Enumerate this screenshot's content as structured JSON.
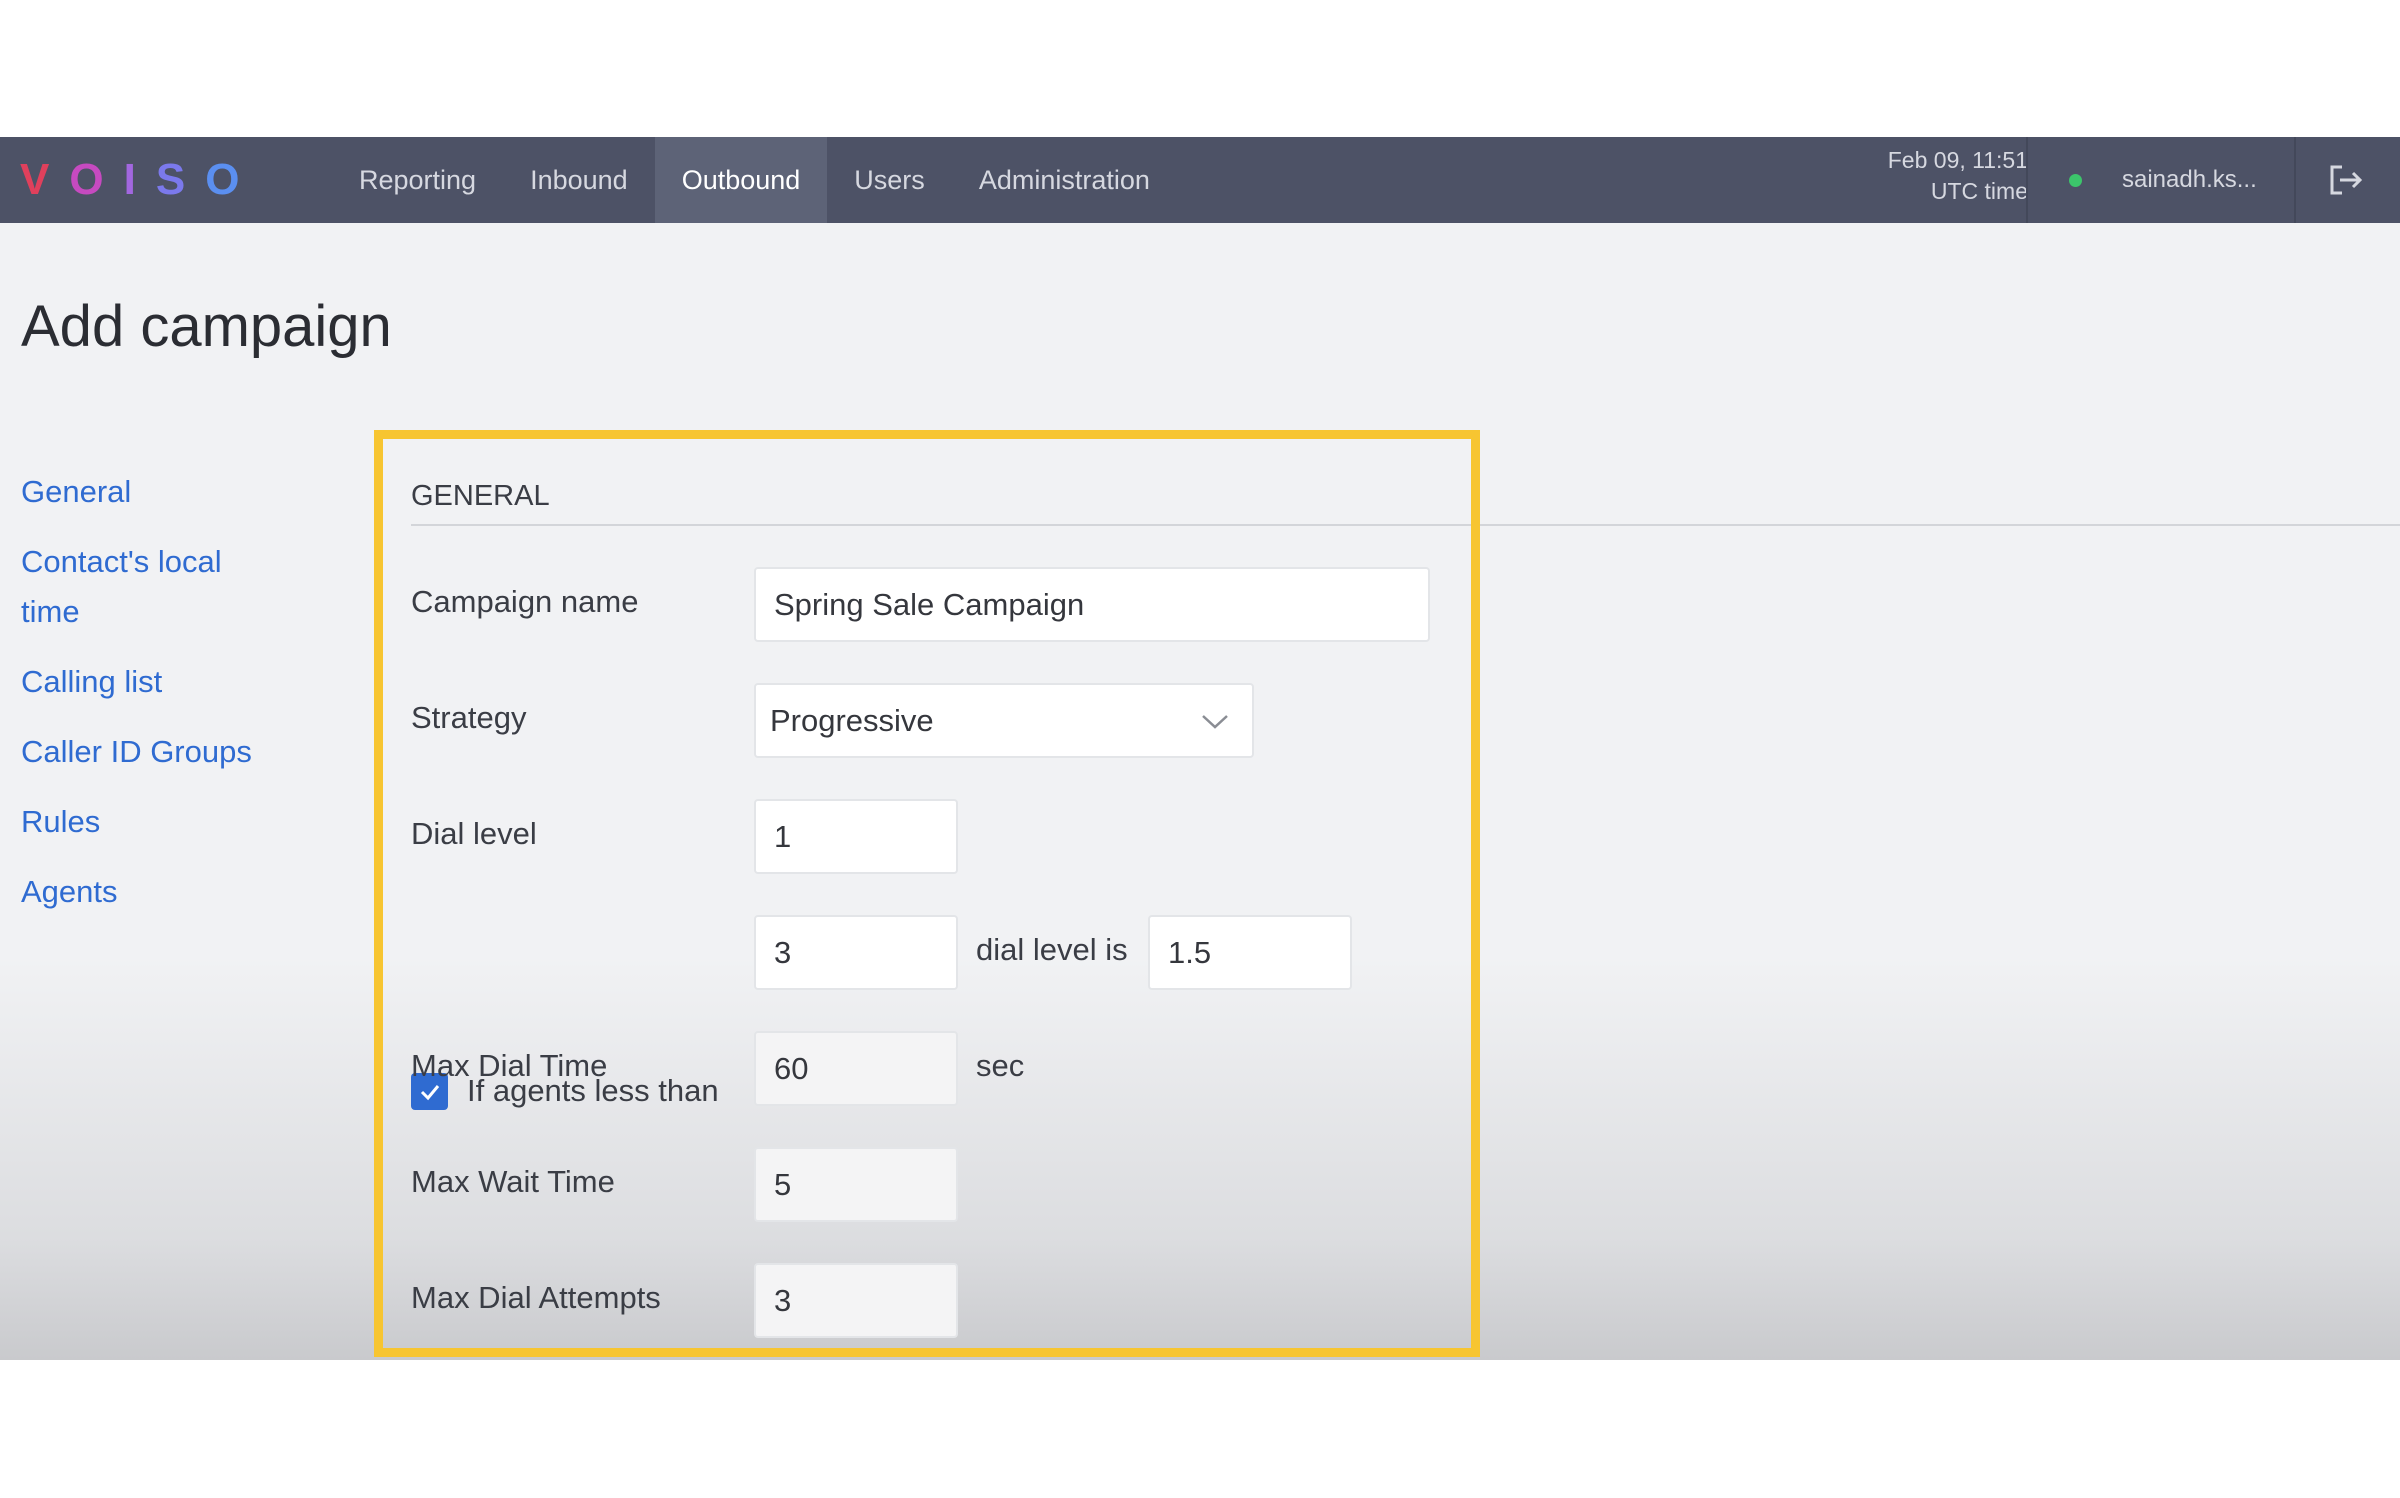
{
  "logo": {
    "letters": [
      "V",
      "O",
      "I",
      "S",
      "O"
    ],
    "colors": [
      "#e0405c",
      "#c64ac0",
      "#a267e0",
      "#7b79ec",
      "#5b8ff0"
    ]
  },
  "nav": {
    "items": [
      "Reporting",
      "Inbound",
      "Outbound",
      "Users",
      "Administration"
    ],
    "active": "Outbound"
  },
  "clock": {
    "date_time": "Feb 09, 11:51",
    "zone": "UTC time"
  },
  "user": {
    "name": "sainadh.ks...",
    "status_color": "#3cc56b"
  },
  "page": {
    "title": "Add campaign"
  },
  "sidebar": {
    "items": [
      "General",
      "Contact's local time",
      "Calling list",
      "Caller ID Groups",
      "Rules",
      "Agents"
    ]
  },
  "general": {
    "section_title": "GENERAL",
    "campaign_name_label": "Campaign name",
    "campaign_name_value": "Spring Sale Campaign",
    "strategy_label": "Strategy",
    "strategy_value": "Progressive",
    "dial_level_label": "Dial level",
    "dial_level_value": "1",
    "agents_checkbox_label": "If agents less than",
    "agents_checked": true,
    "agents_value": "3",
    "dial_level_is_label": "dial level is",
    "dial_level_is_value": "1.5",
    "max_dial_time_label": "Max Dial Time",
    "max_dial_time_value": "60",
    "max_dial_time_unit": "sec",
    "max_wait_time_label": "Max Wait Time",
    "max_wait_time_value": "5",
    "max_dial_attempts_label": "Max Dial Attempts",
    "max_dial_attempts_value": "3"
  },
  "colors": {
    "topbar": "#4d5266",
    "link": "#2f6bd1",
    "highlight": "#f7c531"
  }
}
